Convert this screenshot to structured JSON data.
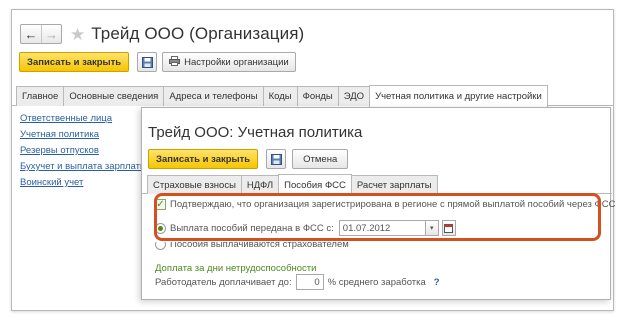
{
  "window": {
    "title": "Трейд ООО (Организация)",
    "nav": {
      "back_glyph": "←",
      "forward_glyph": "→"
    },
    "toolbar": {
      "save_close_label": "Записать и закрыть",
      "org_settings_label": "Настройки организации"
    },
    "tabs": [
      {
        "label": "Главное"
      },
      {
        "label": "Основные сведения"
      },
      {
        "label": "Адреса и телефоны"
      },
      {
        "label": "Коды"
      },
      {
        "label": "Фонды"
      },
      {
        "label": "ЭДО"
      },
      {
        "label": "Учетная политика и другие настройки"
      }
    ],
    "active_tab": 6
  },
  "sidebar": {
    "items": [
      {
        "label": "Ответственные лица"
      },
      {
        "label": "Учетная политика"
      },
      {
        "label": "Резервы отпусков"
      },
      {
        "label": "Бухучет и выплата зарплаты"
      },
      {
        "label": "Воинский учет"
      }
    ]
  },
  "dialog": {
    "title": "Трейд ООО: Учетная политика",
    "toolbar": {
      "save_close_label": "Записать и закрыть",
      "cancel_label": "Отмена"
    },
    "tabs": [
      {
        "label": "Страховые взносы"
      },
      {
        "label": "НДФЛ"
      },
      {
        "label": "Пособия ФСС"
      },
      {
        "label": "Расчет зарплаты"
      }
    ],
    "active_tab": 2,
    "confirm_checkbox": {
      "label": "Подтверждаю, что организация зарегистрирована в регионе с прямой выплатой пособий через ФСС",
      "checked": true
    },
    "radio_transferred": {
      "label": "Выплата пособий передана в ФСС с:",
      "selected": true,
      "date_value": "01.07.2012"
    },
    "radio_employer": {
      "label": "Пособия выплачиваются страхователем",
      "selected": false
    },
    "sick_section_title": "Доплата за дни нетрудоспособности",
    "employer_pays": {
      "label": "Работодатель доплачивает до:",
      "value": "0",
      "suffix": "% среднего заработка",
      "help": "?"
    }
  },
  "colors": {
    "accent_yellow": "#f6c500",
    "highlight_frame": "#d4511f",
    "link": "#2b5ea8",
    "green": "#4d8a1d"
  }
}
